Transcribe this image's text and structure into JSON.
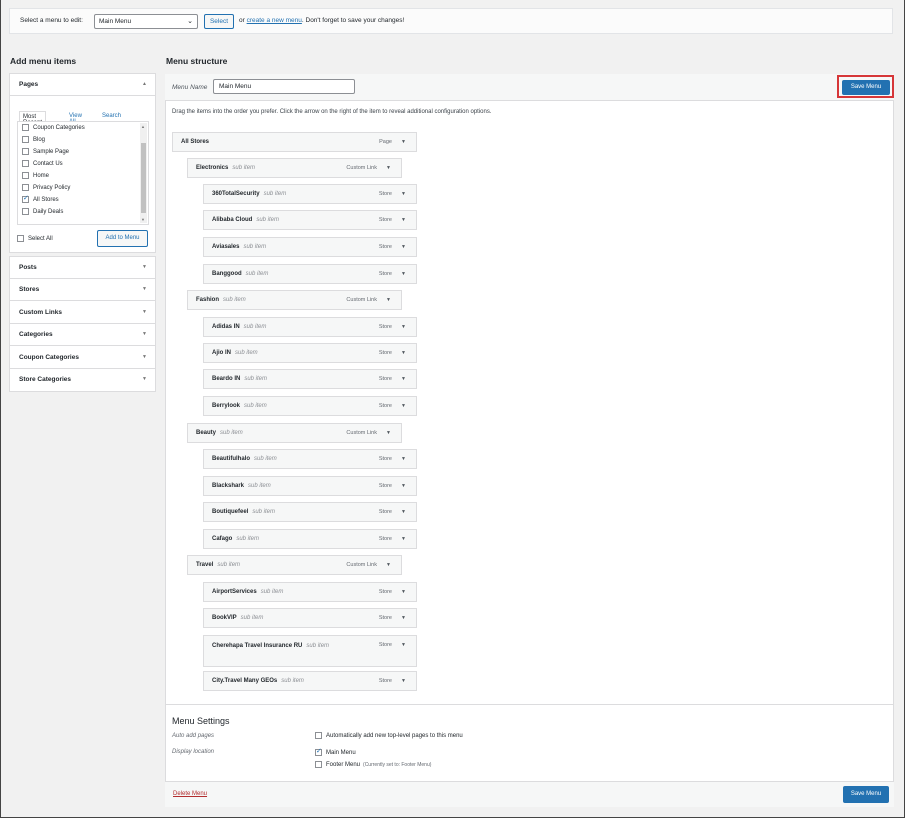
{
  "topbar": {
    "label": "Select a menu to edit:",
    "selected_menu": "Main Menu",
    "select_button": "Select",
    "or_text": "or",
    "create_link": "create a new menu",
    "reminder": ". Don't forget to save your changes!"
  },
  "left": {
    "heading": "Add menu items",
    "pages": {
      "title": "Pages",
      "tabs": [
        "Most Recent",
        "View All",
        "Search"
      ],
      "items": [
        {
          "label": "Coupon Categories",
          "checked": false
        },
        {
          "label": "Blog",
          "checked": false
        },
        {
          "label": "Sample Page",
          "checked": false
        },
        {
          "label": "Contact Us",
          "checked": false
        },
        {
          "label": "Home",
          "checked": false
        },
        {
          "label": "Privacy Policy",
          "checked": false
        },
        {
          "label": "All Stores",
          "checked": true
        },
        {
          "label": "Daily Deals",
          "checked": false
        }
      ],
      "select_all": "Select All",
      "add_button": "Add to Menu"
    },
    "sections": [
      "Posts",
      "Stores",
      "Custom Links",
      "Categories",
      "Coupon Categories",
      "Store Categories"
    ]
  },
  "right": {
    "heading": "Menu structure",
    "menu_name_label": "Menu Name",
    "menu_name_value": "Main Menu",
    "save_button": "Save Menu",
    "instructions": "Drag the items into the order you prefer. Click the arrow on the right of the item to reveal additional configuration options.",
    "sub_item_label": "sub item",
    "items": [
      {
        "title": "All Stores",
        "sub": false,
        "type": "Page",
        "depth": 0
      },
      {
        "title": "Electronics",
        "sub": true,
        "type": "Custom Link",
        "depth": 1
      },
      {
        "title": "360TotalSecurity",
        "sub": true,
        "type": "Store",
        "depth": 2
      },
      {
        "title": "Alibaba Cloud",
        "sub": true,
        "type": "Store",
        "depth": 2
      },
      {
        "title": "Aviasales",
        "sub": true,
        "type": "Store",
        "depth": 2
      },
      {
        "title": "Banggood",
        "sub": true,
        "type": "Store",
        "depth": 2
      },
      {
        "title": "Fashion",
        "sub": true,
        "type": "Custom Link",
        "depth": 1
      },
      {
        "title": "Adidas IN",
        "sub": true,
        "type": "Store",
        "depth": 2
      },
      {
        "title": "Ajio IN",
        "sub": true,
        "type": "Store",
        "depth": 2
      },
      {
        "title": "Beardo IN",
        "sub": true,
        "type": "Store",
        "depth": 2
      },
      {
        "title": "Berrylook",
        "sub": true,
        "type": "Store",
        "depth": 2
      },
      {
        "title": "Beauty",
        "sub": true,
        "type": "Custom Link",
        "depth": 1
      },
      {
        "title": "Beautifulhalo",
        "sub": true,
        "type": "Store",
        "depth": 2
      },
      {
        "title": "Blackshark",
        "sub": true,
        "type": "Store",
        "depth": 2
      },
      {
        "title": "Boutiquefeel",
        "sub": true,
        "type": "Store",
        "depth": 2
      },
      {
        "title": "Cafago",
        "sub": true,
        "type": "Store",
        "depth": 2
      },
      {
        "title": "Travel",
        "sub": true,
        "type": "Custom Link",
        "depth": 1
      },
      {
        "title": "AirportServices",
        "sub": true,
        "type": "Store",
        "depth": 2
      },
      {
        "title": "BookVIP",
        "sub": true,
        "type": "Store",
        "depth": 2
      },
      {
        "title": "Cherehapa Travel Insurance RU",
        "sub": true,
        "type": "Store",
        "depth": 2,
        "tall": true
      },
      {
        "title": "City.Travel Many GEOs",
        "sub": true,
        "type": "Store",
        "depth": 2
      }
    ],
    "settings": {
      "title": "Menu Settings",
      "auto_add_label": "Auto add pages",
      "auto_add_option": "Automatically add new top-level pages to this menu",
      "display_label": "Display location",
      "locations": [
        {
          "label": "Main Menu",
          "checked": true,
          "note": ""
        },
        {
          "label": "Footer Menu",
          "checked": false,
          "note": "(Currently set to: Footer Menu)"
        }
      ]
    },
    "delete_link": "Delete Menu"
  },
  "colors": {
    "primary": "#2271b1",
    "highlight": "#d63638",
    "delete": "#b32d2e"
  }
}
